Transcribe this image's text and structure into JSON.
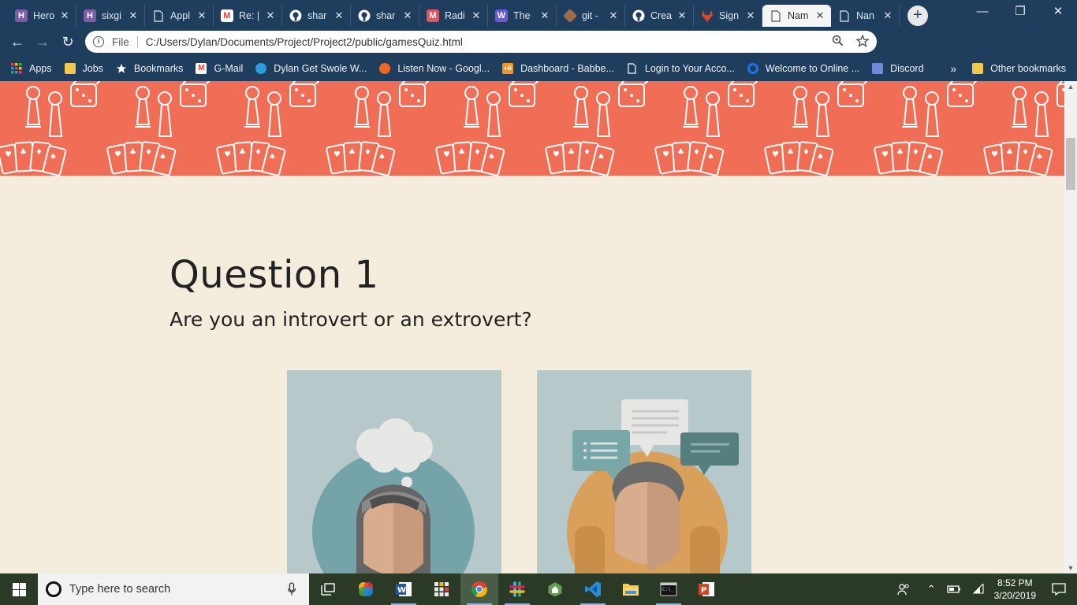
{
  "browser": {
    "tabs": [
      {
        "title": "Hero",
        "icon": "heroku-icon",
        "color": "#7b5ea7",
        "glyph": "H"
      },
      {
        "title": "sixgi",
        "icon": "heroku-icon",
        "color": "#7b5ea7",
        "glyph": "H"
      },
      {
        "title": "Appl",
        "icon": "page-icon",
        "color": "",
        "glyph": ""
      },
      {
        "title": "Re: |",
        "icon": "gmail-icon",
        "color": "#ea4335",
        "glyph": "M"
      },
      {
        "title": "shar",
        "icon": "github-icon",
        "color": "#ffffff",
        "glyph": ""
      },
      {
        "title": "shar",
        "icon": "github-icon",
        "color": "#ffffff",
        "glyph": ""
      },
      {
        "title": "Radi",
        "icon": "m-icon",
        "color": "#e05563",
        "glyph": "M"
      },
      {
        "title": "The",
        "icon": "w-icon",
        "color": "#6a5bd6",
        "glyph": "W"
      },
      {
        "title": "git -",
        "icon": "git-icon",
        "color": "#9b6b4a",
        "glyph": ""
      },
      {
        "title": "Crea",
        "icon": "github-icon",
        "color": "#ffffff",
        "glyph": ""
      },
      {
        "title": "Sign",
        "icon": "gitlab-icon",
        "color": "#e2432a",
        "glyph": ""
      },
      {
        "title": "Nam",
        "icon": "page-icon",
        "color": "",
        "glyph": "",
        "active": true
      },
      {
        "title": "Nan",
        "icon": "page-icon",
        "color": "",
        "glyph": ""
      }
    ],
    "close_glyph": "✕",
    "new_tab_glyph": "+",
    "window_controls": {
      "minimize": "—",
      "restore": "❐",
      "close": "✕"
    },
    "nav": {
      "back": "←",
      "forward": "→",
      "reload": "↻"
    },
    "url_scheme": "File",
    "url": "C:/Users/Dylan/Documents/Project/Project2/public/gamesQuiz.html",
    "bookmarks": [
      {
        "label": "Apps",
        "icon": "apps-grid-icon",
        "color": "#e8a33d"
      },
      {
        "label": "Jobs",
        "icon": "folder-icon",
        "color": "#f2c94c"
      },
      {
        "label": "Bookmarks",
        "icon": "star-icon",
        "color": "#ffffff"
      },
      {
        "label": "G-Mail",
        "icon": "gmail-icon",
        "color": "#ea4335"
      },
      {
        "label": "Dylan Get Swole W...",
        "icon": "edge-icon",
        "color": "#2d9cdb"
      },
      {
        "label": "Listen Now - Googl...",
        "icon": "music-icon",
        "color": "#f26522"
      },
      {
        "label": "Dashboard - Babbe...",
        "icon": "babbel-icon",
        "color": "#f7941d"
      },
      {
        "label": "Login to Your Acco...",
        "icon": "page-icon",
        "color": "#ffffff"
      },
      {
        "label": "Welcome to Online ...",
        "icon": "circle-icon",
        "color": "#1a73e8"
      },
      {
        "label": "Discord",
        "icon": "discord-icon",
        "color": "#7289da"
      }
    ],
    "bookmarks_overflow": "»",
    "other_bookmarks": "Other bookmarks"
  },
  "page": {
    "question_title": "Question 1",
    "question_text": "Are you an introvert or an extrovert?",
    "choices": [
      {
        "name": "introvert",
        "image": "introvert-illustration"
      },
      {
        "name": "extrovert",
        "image": "extrovert-illustration"
      }
    ],
    "banner_color": "#f06e55",
    "background_color": "#f4ecdc"
  },
  "taskbar": {
    "search_placeholder": "Type here to search",
    "time": "8:52 PM",
    "date": "3/20/2019"
  }
}
